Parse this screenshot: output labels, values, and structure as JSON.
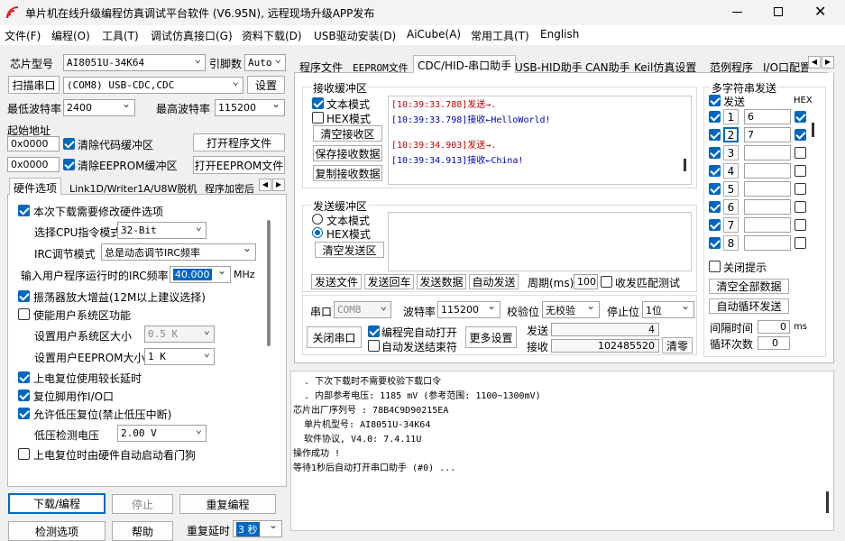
{
  "window": {
    "title": "单片机在线升级编程仿真调试平台软件 (V6.95N), 远程现场升级APP发布"
  },
  "menu": [
    "文件(F)",
    "编程(O)",
    "工具(T)",
    "调试仿真接口(G)",
    "资料下载(D)",
    "USB驱动安装(D)",
    "AiCube(A)",
    "常用工具(T)",
    "English"
  ],
  "left": {
    "chip_label": "芯片型号",
    "chip_value": "AI8051U-34K64",
    "pin_label": "引脚数",
    "pin_value": "Auto",
    "scan_btn": "扫描串口",
    "port_value": "(COM8) USB-CDC,CDC",
    "settings_btn": "设置",
    "min_baud_label": "最低波特率",
    "min_baud_value": "2400",
    "max_baud_label": "最高波特率",
    "max_baud_value": "115200",
    "start_addr_label": "起始地址",
    "addr1": "0x0000",
    "clear_code": "清除代码缓冲区",
    "open_prog": "打开程序文件",
    "addr2": "0x0000",
    "clear_eeprom": "清除EEPROM缓冲区",
    "open_eeprom": "打开EEPROM文件",
    "tabs": [
      "硬件选项",
      "Link1D/Writer1A/U8W脱机",
      "程序加密后"
    ],
    "opts": {
      "modify_hw": "本次下载需要修改硬件选项",
      "cpu_label": "选择CPU指令模式",
      "cpu_value": "32-Bit",
      "irc_label": "IRC调节模式",
      "irc_value": "总是动态调节IRC频率",
      "freq_label": "输入用户程序运行时的IRC频率",
      "freq_value": "40.000",
      "freq_unit": "MHz",
      "osc": "振荡器放大增益(12M以上建议选择)",
      "user_sys": "使能用户系统区功能",
      "sys_size_label": "设置用户系统区大小",
      "sys_size_value": "0.5 K",
      "eeprom_size_label": "设置用户EEPROM大小",
      "eeprom_size_value": "1   K",
      "reset_delay": "上电复位使用较长延时",
      "reset_io": "复位脚用作I/O口",
      "lvd": "允许低压复位(禁止低压中断)",
      "lvd_label": "低压检测电压",
      "lvd_value": "2.00 V",
      "wdt": "上电复位时由硬件自动启动看门狗"
    },
    "download_btn": "下载/编程",
    "stop_btn": "停止",
    "repeat_btn": "重复编程",
    "detect_btn": "检测选项",
    "help_btn": "帮助",
    "repeat_delay_label": "重复延时",
    "repeat_delay_value": "3 秒"
  },
  "right": {
    "tabs": [
      "程序文件",
      "EEPROM文件",
      "CDC/HID-串口助手",
      "USB-HID助手",
      "CAN助手",
      "Keil仿真设置",
      "范例程序",
      "I/O口配置"
    ],
    "rx": {
      "title": "接收缓冲区",
      "text_mode": "文本模式",
      "hex_mode": "HEX模式",
      "clear_btn": "清空接收区",
      "save_btn": "保存接收数据",
      "copy_btn": "复制接收数据",
      "lines": [
        {
          "ts": "[10:39:33.788]",
          "dir": "发送→",
          "msg": "."
        },
        {
          "ts": "[10:39:33.798]",
          "dir": "接收←",
          "msg": "HelloWorld!"
        },
        {
          "ts": "[10:39:34.903]",
          "dir": "发送→",
          "msg": "."
        },
        {
          "ts": "[10:39:34.913]",
          "dir": "接收←",
          "msg": "China!"
        }
      ]
    },
    "tx": {
      "title": "发送缓冲区",
      "text_mode": "文本模式",
      "hex_mode": "HEX模式",
      "clear_btn": "清空发送区",
      "send_file": "发送文件",
      "send_enter": "发送回车",
      "send_data": "发送数据",
      "auto_send": "自动发送",
      "period_label": "周期(ms)",
      "period_value": "100",
      "match": "收发匹配测试"
    },
    "serial": {
      "port_label": "串口",
      "port_value": "COM8",
      "baud_label": "波特率",
      "baud_value": "115200",
      "parity_label": "校验位",
      "parity_value": "无校验",
      "stop_label": "停止位",
      "stop_value": "1位",
      "close_btn": "关闭串口",
      "auto_open": "编程完自动打开",
      "auto_close": "自动发送结束符",
      "more_btn": "更多设置",
      "send_label": "发送",
      "send_count": "4",
      "recv_label": "接收",
      "recv_count": "102485520",
      "clear_btn": "清零"
    },
    "multi": {
      "title": "多字符串发送",
      "send_hdr": "发送",
      "hex_hdr": "HEX",
      "rows": [
        {
          "n": "1",
          "v": "6"
        },
        {
          "n": "2",
          "v": "7"
        },
        {
          "n": "3",
          "v": ""
        },
        {
          "n": "4",
          "v": ""
        },
        {
          "n": "5",
          "v": ""
        },
        {
          "n": "6",
          "v": ""
        },
        {
          "n": "7",
          "v": ""
        },
        {
          "n": "8",
          "v": ""
        }
      ],
      "close_tip": "关闭提示",
      "clear_all": "清空全部数据",
      "auto_loop": "自动循环发送",
      "interval_label": "间隔时间",
      "interval_value": "0",
      "interval_unit": "ms",
      "loop_label": "循环次数",
      "loop_value": "0"
    },
    "log": [
      "  . 下次下载时不需要校验下载口令",
      "  . 内部参考电压: 1185 mV (参考范围: 1100~1300mV)",
      "芯片出厂序列号 : 78B4C9D90215EA",
      "",
      "  单片机型号: AI8051U-34K64",
      "  软件协议, V4.0: 7.4.11U",
      "",
      "操作成功 !",
      "",
      "等待1秒后自动打开串口助手 (#0) ..."
    ]
  },
  "colors": {
    "accent": "#0067c0",
    "send_red": "#c00000",
    "recv_blue": "#0000c0"
  }
}
